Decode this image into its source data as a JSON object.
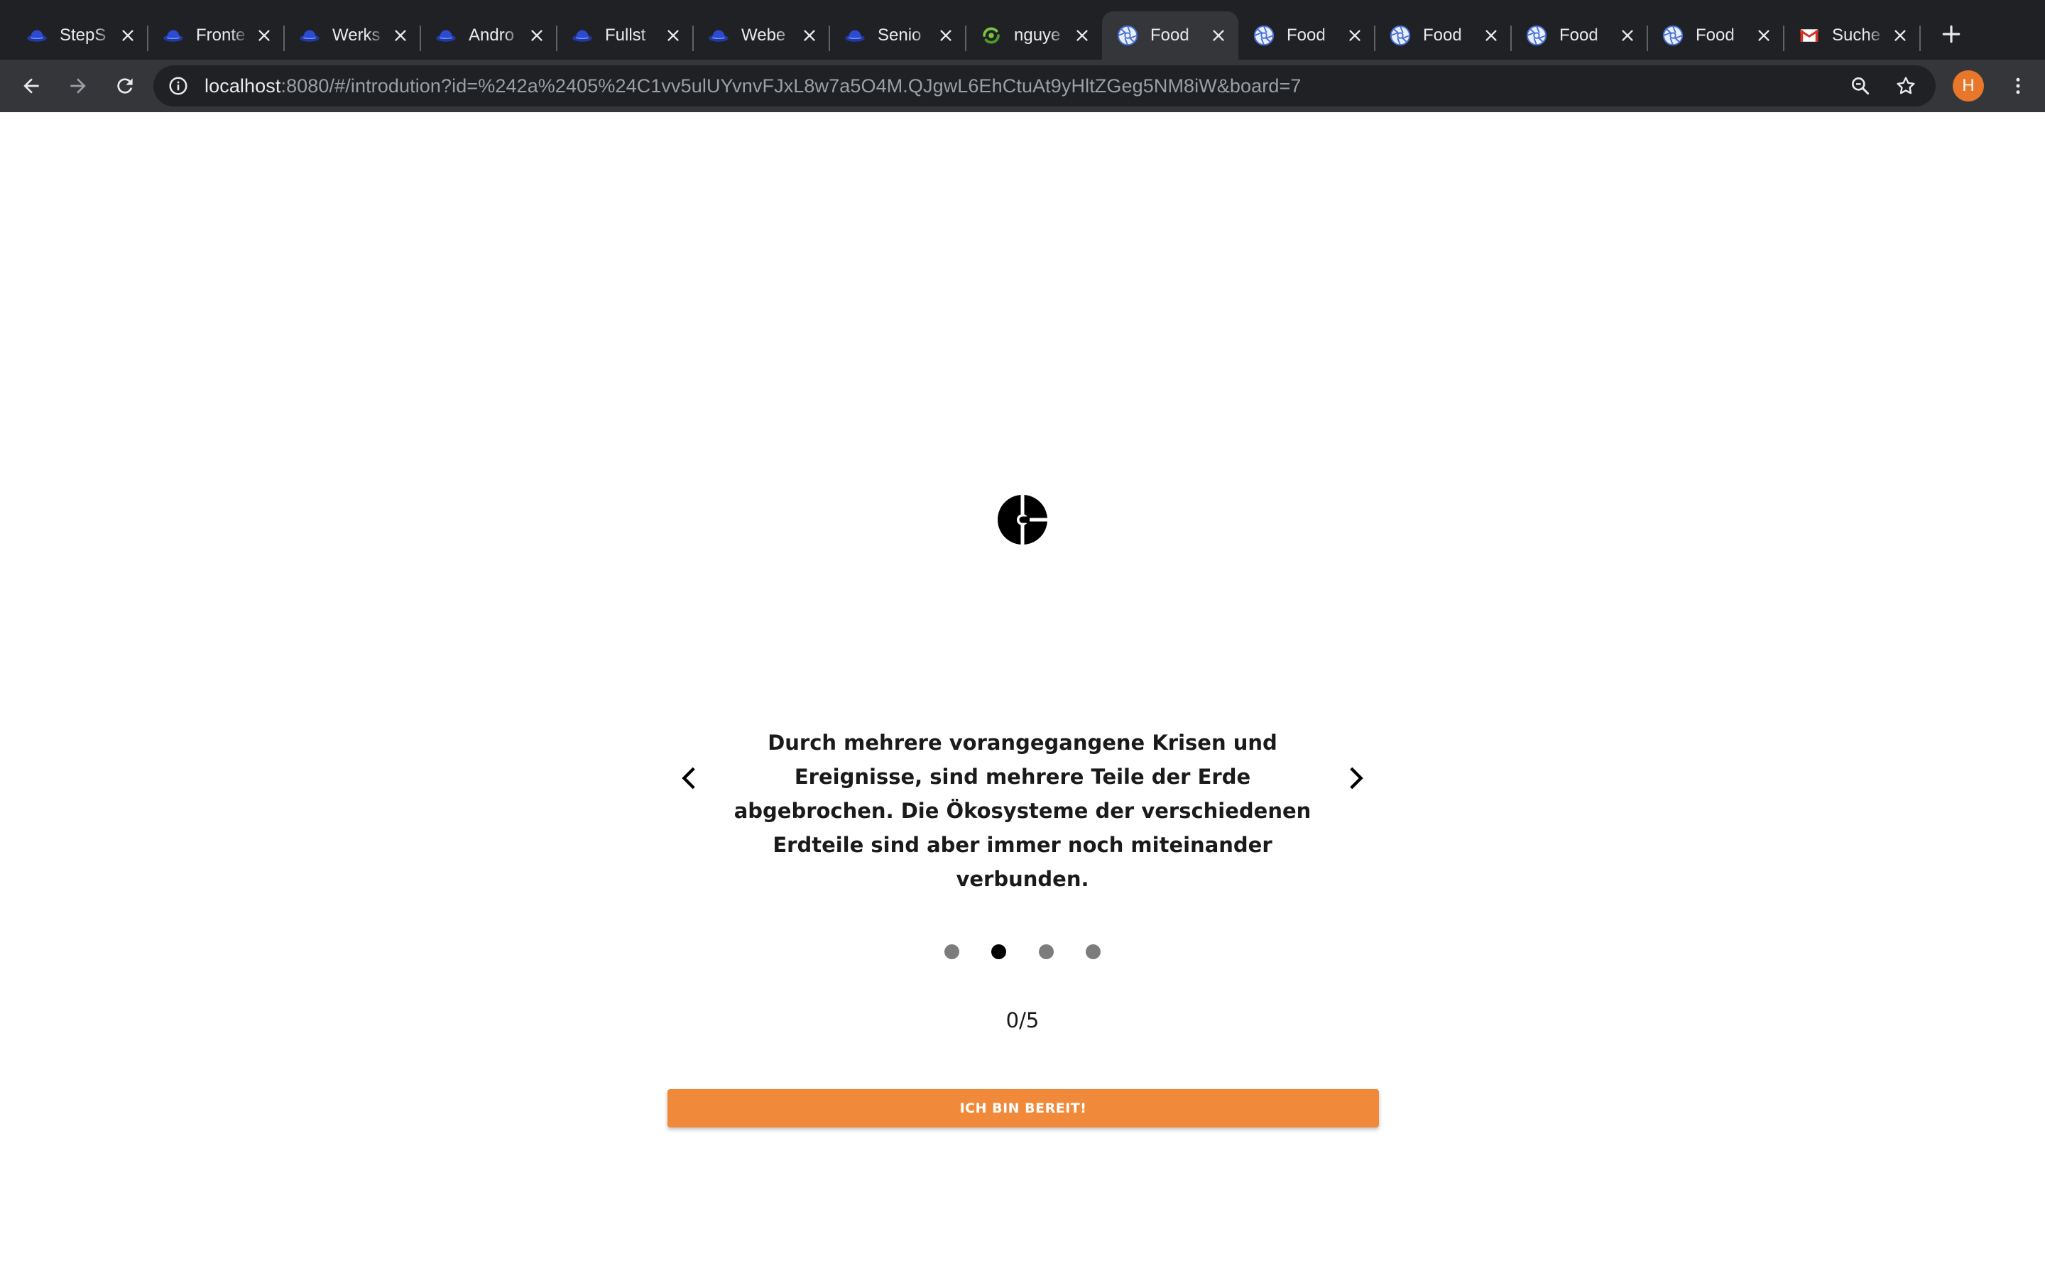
{
  "browser": {
    "tabs": [
      {
        "title": "StepS",
        "icon": "blue-hat-icon",
        "active": false
      },
      {
        "title": "Fronte",
        "icon": "blue-hat-icon",
        "active": false
      },
      {
        "title": "Werks",
        "icon": "blue-hat-icon",
        "active": false
      },
      {
        "title": "Andro",
        "icon": "blue-hat-icon",
        "active": false
      },
      {
        "title": "Fullst",
        "icon": "blue-hat-icon",
        "active": false
      },
      {
        "title": "Webe",
        "icon": "blue-hat-icon",
        "active": false
      },
      {
        "title": "Senio",
        "icon": "blue-hat-icon",
        "active": false
      },
      {
        "title": "nguye",
        "icon": "green-swirl-icon",
        "active": false
      },
      {
        "title": "Food",
        "icon": "aperture-icon",
        "active": true
      },
      {
        "title": "Food",
        "icon": "aperture-icon",
        "active": false
      },
      {
        "title": "Food",
        "icon": "aperture-icon",
        "active": false
      },
      {
        "title": "Food",
        "icon": "aperture-icon",
        "active": false
      },
      {
        "title": "Food",
        "icon": "aperture-icon",
        "active": false
      },
      {
        "title": "Suche",
        "icon": "gmail-icon",
        "active": false
      }
    ],
    "url_host": "localhost",
    "url_rest": ":8080/#/introdution?id=%242a%2405%24C1vv5ulUYvnvFJxL8w7a5O4M.QJgwL6EhCtuAt9yHltZGeg5NM8iW&board=7",
    "profile_initial": "H",
    "profile_color": "#e8762b"
  },
  "intro": {
    "slide_text": "Durch mehrere vorangegangene Krisen und Ereignisse, sind mehrere Teile der Erde abgebrochen. Die Ökosysteme der verschiedenen Erdteile sind aber immer noch miteinander verbunden.",
    "dots": [
      {
        "active": false
      },
      {
        "active": true
      },
      {
        "active": false
      },
      {
        "active": false
      }
    ],
    "progress": "0/5",
    "button_label": "ICH BIN BEREIT!",
    "button_color": "#f08a3a"
  }
}
